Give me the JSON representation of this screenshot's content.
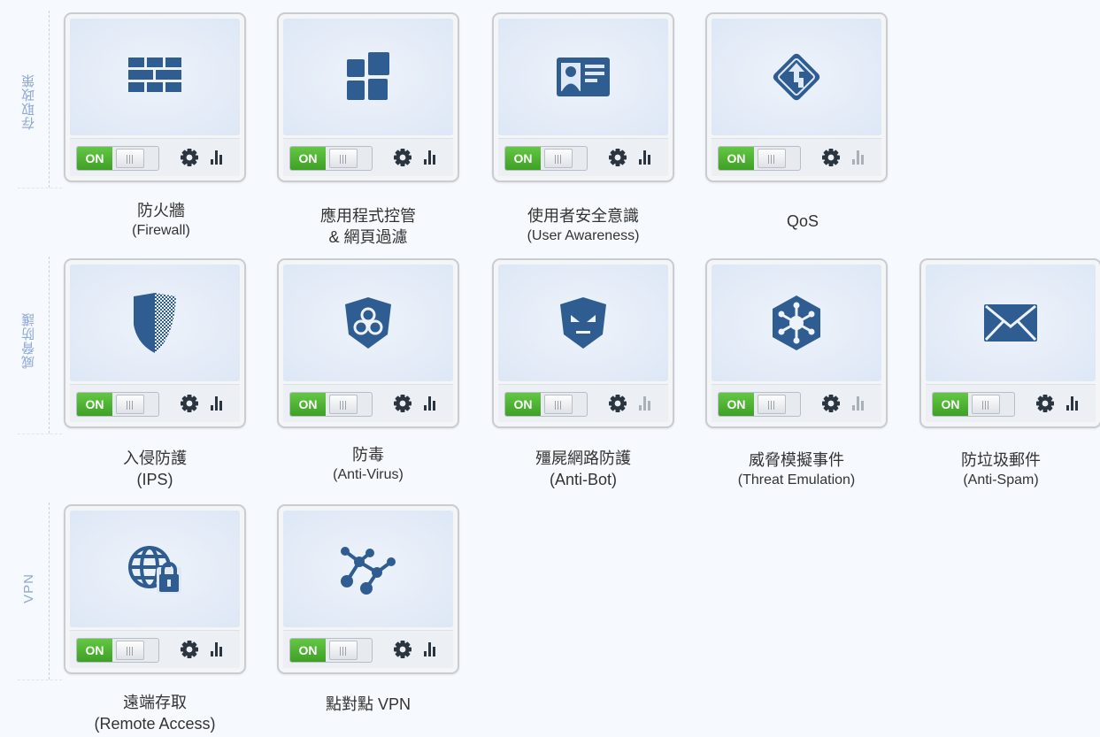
{
  "sections": {
    "access_policy": "存取政策",
    "threat_prevention": "威脅防護",
    "vpn": "VPN"
  },
  "toggle_label": "ON",
  "icon_names": {
    "firewall": "brick-wall-icon",
    "app_control": "blocks-icon",
    "user_awareness": "id-card-icon",
    "qos": "diamond-arrow-icon",
    "ips": "shield-icon",
    "anti_virus": "biohazard-icon",
    "anti_bot": "bot-shield-icon",
    "threat_emulation": "virus-hexagon-icon",
    "anti_spam": "envelope-icon",
    "remote_access": "globe-lock-icon",
    "p2p_vpn": "network-nodes-icon"
  },
  "colors": {
    "icon": "#2f5d92",
    "toggle_on": "#4caf2e",
    "section_label": "#8fa8d6"
  },
  "blades": {
    "firewall": {
      "title": "防火牆",
      "subtitle": "(Firewall)"
    },
    "app_control": {
      "title": "應用程式控管",
      "subtitle": "& 網頁過濾"
    },
    "user_awareness": {
      "title": "使用者安全意識",
      "subtitle": "(User Awareness)"
    },
    "qos": {
      "title": "QoS"
    },
    "ips": {
      "title": "入侵防護",
      "subtitle": "(IPS)"
    },
    "anti_virus": {
      "title": "防毒",
      "subtitle": "(Anti-Virus)"
    },
    "anti_bot": {
      "title": "殭屍網路防護",
      "subtitle": "(Anti-Bot)"
    },
    "threat_emulation": {
      "title": "威脅模擬事件",
      "subtitle": "(Threat Emulation)"
    },
    "anti_spam": {
      "title": "防垃圾郵件",
      "subtitle": "(Anti-Spam)"
    },
    "remote_access": {
      "title": "遠端存取",
      "subtitle": "(Remote Access)"
    },
    "p2p_vpn": {
      "title": "點對點 VPN"
    }
  }
}
